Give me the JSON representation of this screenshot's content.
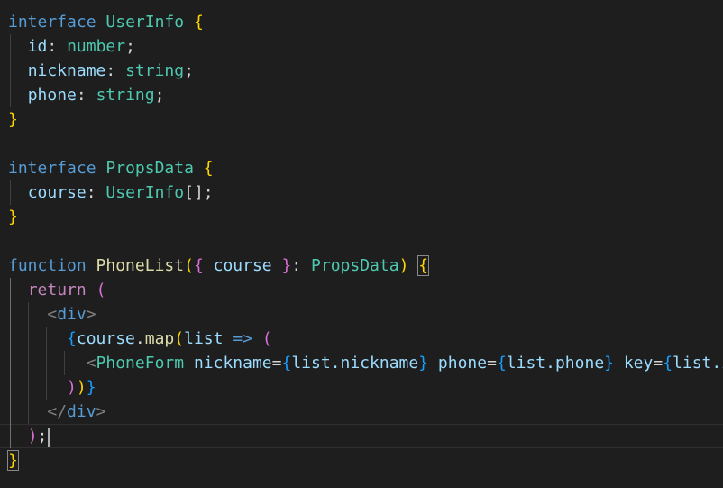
{
  "code": {
    "line1": {
      "kw": "interface",
      "name": "UserInfo",
      "open": "{"
    },
    "line2": {
      "prop": "id",
      "type": "number"
    },
    "line3": {
      "prop": "nickname",
      "type": "string"
    },
    "line4": {
      "prop": "phone",
      "type": "string"
    },
    "line5": {
      "close": "}"
    },
    "line7": {
      "kw": "interface",
      "name": "PropsData",
      "open": "{"
    },
    "line8": {
      "prop": "course",
      "type": "UserInfo",
      "suffix": "[];"
    },
    "line9": {
      "close": "}"
    },
    "line11": {
      "kw": "function",
      "name": "PhoneList",
      "param": "course",
      "type": "PropsData",
      "open": "{"
    },
    "line12": {
      "kw": "return",
      "paren": "("
    },
    "line13": {
      "tag": "div"
    },
    "line14": {
      "obj": "course",
      "method": "map",
      "param": "list",
      "arrow": "=>",
      "paren": "("
    },
    "line15": {
      "comp": "PhoneForm",
      "attr1": "nickname",
      "val1": "list.nickname",
      "attr2": "phone",
      "val2": "list.phone",
      "attr3": "key",
      "val3": "list.id",
      "selfclose": "/>"
    },
    "line16": {
      "close": "))}"
    },
    "line17": {
      "tag": "div"
    },
    "line18": {
      "close": ");"
    },
    "line19": {
      "close": "}"
    }
  },
  "colors": {
    "background": "#1e1e1e",
    "keyword": "#569cd6",
    "control": "#c586c0",
    "type": "#4ec9b0",
    "property": "#9cdcfe",
    "function": "#dcdcaa"
  }
}
